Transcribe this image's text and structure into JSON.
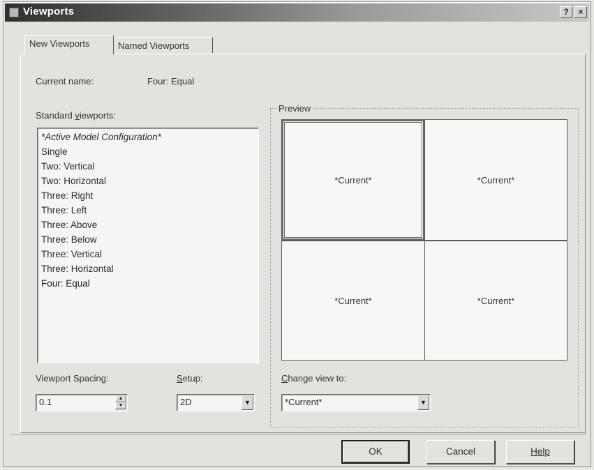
{
  "window": {
    "title": "Viewports",
    "help_glyph": "?",
    "close_glyph": "×"
  },
  "tabs": [
    {
      "label": "New Viewports",
      "active": true
    },
    {
      "label": "Named Viewports",
      "active": false
    }
  ],
  "current_name": {
    "label": "Current name:",
    "value": "Four: Equal"
  },
  "standard_viewports": {
    "label": "Standard viewports:",
    "items": [
      "*Active Model Configuration*",
      "Single",
      "Two: Vertical",
      "Two: Horizontal",
      "Three: Right",
      "Three: Left",
      "Three: Above",
      "Three: Below",
      "Three: Vertical",
      "Three: Horizontal",
      "Four: Equal"
    ],
    "selected": "Four: Equal"
  },
  "preview": {
    "label": "Preview",
    "cells": [
      "*Current*",
      "*Current*",
      "*Current*",
      "*Current*"
    ]
  },
  "viewport_spacing": {
    "label": "Viewport Spacing:",
    "value": "0.1"
  },
  "setup": {
    "label": "Setup:",
    "value": "2D"
  },
  "change_view": {
    "label": "Change view to:",
    "value": "*Current*"
  },
  "buttons": {
    "ok": "OK",
    "cancel": "Cancel",
    "help": "Help"
  },
  "icons": {
    "spin_up": "▲",
    "spin_down": "▼",
    "dropdown": "▼"
  }
}
